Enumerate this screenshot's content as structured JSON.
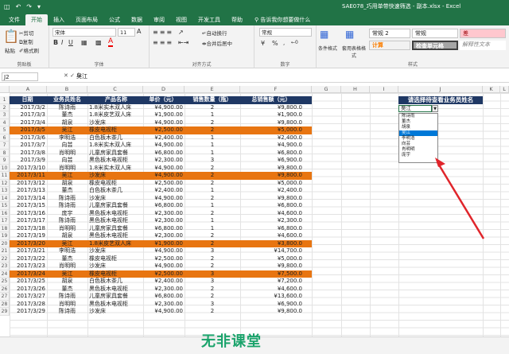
{
  "titlebar": {
    "filename": "SAE078_巧用单带快速筛选 - 副本.xlsx - Excel"
  },
  "tabs": [
    "文件",
    "开始",
    "插入",
    "页面布局",
    "公式",
    "数据",
    "审阅",
    "视图",
    "开发工具",
    "帮助"
  ],
  "tell_me": "告诉我你想要做什么",
  "ribbon": {
    "clipboard": {
      "paste": "粘贴",
      "cut": "剪切",
      "copy": "复制",
      "format_painter": "格式刷",
      "label": "剪贴板"
    },
    "font": {
      "name": "宋体",
      "size": "11",
      "bold": "B",
      "italic": "I",
      "underline": "U",
      "label": "字体",
      "grow": "A",
      "font_color_sample": "A"
    },
    "alignment": {
      "wrap": "自动换行",
      "merge": "合并后居中",
      "label": "对齐方式"
    },
    "number": {
      "format": "常规",
      "label": "数字",
      "percent": "%"
    },
    "styles": {
      "conditional": "条件格式",
      "table": "套用表格格式",
      "normal2": "常规 2",
      "normal": "常规",
      "bad": "差",
      "calc": "计算",
      "check": "检查单元格",
      "explain": "解释性文本",
      "label": "样式"
    }
  },
  "namebox": "J2",
  "formula": "吴江",
  "columns": [
    "A",
    "B",
    "C",
    "D",
    "E",
    "F",
    "G",
    "H",
    "I",
    "J",
    "K",
    "L"
  ],
  "row_numbers": [
    "1",
    "2",
    "3",
    "4",
    "5",
    "6",
    "7",
    "8",
    "9",
    "10",
    "11",
    "12",
    "13",
    "14",
    "15",
    "16",
    "17",
    "18",
    "19",
    "20",
    "21",
    "22",
    "23",
    "24",
    "25",
    "26",
    "27",
    "28",
    "29"
  ],
  "table": {
    "headers": [
      "日期",
      "业务员姓名",
      "产品名称",
      "单价（元）",
      "销售数量（瓶）",
      "总销售额（元）"
    ],
    "rows": [
      [
        "2017/3/2",
        "陈诗雨",
        "1.8米实木双人床",
        "¥4,900.00",
        "2",
        "¥9,800.0"
      ],
      [
        "2017/3/3",
        "董杰",
        "1.8米皮艺双人床",
        "¥1,900.00",
        "1",
        "¥1,900.0"
      ],
      [
        "2017/3/4",
        "胡泉",
        "沙发床",
        "¥4,900.00",
        "2",
        "¥9,800.0"
      ],
      [
        "2017/3/5",
        "吴江",
        "橡皮电视柜",
        "¥2,500.00",
        "2",
        "¥5,000.0"
      ],
      [
        "2017/3/6",
        "李明浩",
        "白色板木茶几",
        "¥2,400.00",
        "1",
        "¥2,400.0"
      ],
      [
        "2017/3/7",
        "向芸",
        "1.8米实木双人床",
        "¥4,900.00",
        "1",
        "¥4,900.0"
      ],
      [
        "2017/3/8",
        "肖明明",
        "儿童房家具套餐",
        "¥6,800.00",
        "1",
        "¥6,800.0"
      ],
      [
        "2017/3/9",
        "向芸",
        "黑色板木电视柜",
        "¥2,300.00",
        "3",
        "¥6,900.0"
      ],
      [
        "2017/3/10",
        "肖明明",
        "1.8米实木双人床",
        "¥4,900.00",
        "2",
        "¥9,800.0"
      ],
      [
        "2017/3/11",
        "吴江",
        "沙发床",
        "¥4,900.00",
        "2",
        "¥9,800.0"
      ],
      [
        "2017/3/12",
        "胡泉",
        "橡皮电视柜",
        "¥2,500.00",
        "2",
        "¥5,000.0"
      ],
      [
        "2017/3/13",
        "董杰",
        "白色板木茶几",
        "¥2,400.00",
        "1",
        "¥2,400.0"
      ],
      [
        "2017/3/14",
        "陈诗雨",
        "沙发床",
        "¥4,900.00",
        "2",
        "¥9,800.0"
      ],
      [
        "2017/3/15",
        "陈诗雨",
        "儿童房家具套餐",
        "¥6,800.00",
        "1",
        "¥6,800.0"
      ],
      [
        "2017/3/16",
        "庞宇",
        "黑色板木电视柜",
        "¥2,300.00",
        "2",
        "¥4,600.0"
      ],
      [
        "2017/3/17",
        "陈诗雨",
        "黑色板木电视柜",
        "¥2,300.00",
        "1",
        "¥2,300.0"
      ],
      [
        "2017/3/18",
        "肖明明",
        "儿童房家具套餐",
        "¥6,800.00",
        "1",
        "¥6,800.0"
      ],
      [
        "2017/3/19",
        "胡泉",
        "黑色板木电视柜",
        "¥2,300.00",
        "2",
        "¥4,600.0"
      ],
      [
        "2017/3/20",
        "吴江",
        "1.8米皮艺双人床",
        "¥1,900.00",
        "2",
        "¥3,800.0"
      ],
      [
        "2017/3/21",
        "李明浩",
        "沙发床",
        "¥4,900.00",
        "3",
        "¥14,700.0"
      ],
      [
        "2017/3/22",
        "董杰",
        "橡皮电视柜",
        "¥2,500.00",
        "2",
        "¥5,000.0"
      ],
      [
        "2017/3/23",
        "肖明明",
        "沙发床",
        "¥4,900.00",
        "2",
        "¥9,800.0"
      ],
      [
        "2017/3/24",
        "吴江",
        "橡皮电视柜",
        "¥2,500.00",
        "3",
        "¥7,500.0"
      ],
      [
        "2017/3/25",
        "胡泉",
        "白色板木茶几",
        "¥2,400.00",
        "3",
        "¥7,200.0"
      ],
      [
        "2017/3/26",
        "董杰",
        "黑色板木电视柜",
        "¥2,300.00",
        "2",
        "¥4,600.0"
      ],
      [
        "2017/3/27",
        "陈诗雨",
        "儿童房家具套餐",
        "¥6,800.00",
        "2",
        "¥13,600.0"
      ],
      [
        "2017/3/28",
        "肖明明",
        "黑色板木电视柜",
        "¥2,300.00",
        "3",
        "¥6,900.0"
      ],
      [
        "2017/3/29",
        "陈诗雨",
        "沙发床",
        "¥4,900.00",
        "2",
        "¥9,800.0"
      ]
    ],
    "highlight_rows": [
      3,
      9,
      18,
      22
    ]
  },
  "selector": {
    "header": "请选择待查看业务员姓名",
    "value": "吴江",
    "options": [
      "陈诗雨",
      "董杰",
      "胡泉",
      "吴江",
      "李明浩",
      "向芸",
      "肖明明",
      "庞宇"
    ],
    "selected_index": 3
  },
  "watermark": "无非课堂",
  "colors": {
    "excel_green": "#217346",
    "header_navy": "#1f3864",
    "highlight_orange": "#e87511",
    "arrow_red": "#e0252b"
  }
}
